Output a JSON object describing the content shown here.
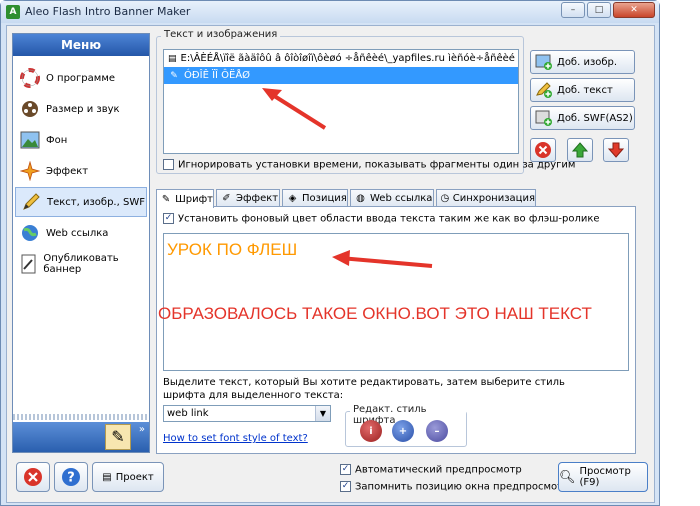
{
  "window": {
    "title": "Aleo Flash Intro Banner Maker"
  },
  "sidebar": {
    "header": "Меню",
    "items": [
      {
        "label": "О программе",
        "icon": "lifebuoy-icon"
      },
      {
        "label": "Размер и звук",
        "icon": "film-reel-icon"
      },
      {
        "label": "Фон",
        "icon": "picture-icon"
      },
      {
        "label": "Эффект",
        "icon": "sparkle-icon"
      },
      {
        "label": "Текст, изобр., SWF",
        "icon": "pencil-icon"
      },
      {
        "label": "Web ссылка",
        "icon": "globe-icon"
      },
      {
        "label": "Опубликовать баннер",
        "icon": "document-icon"
      }
    ]
  },
  "texts_images": {
    "group_title": "Текст и изображения",
    "rows": [
      {
        "text": "E:\\ÂÈÉÅ\\ïîë ãàäîôû â ôîòîøîï\\ôèøó ÷åñêèé\\_yapfiles.ru ìèñóè÷åñêèé ýôôåêò",
        "selected": false
      },
      {
        "text": "ÓÐÎÊ ÏÎ ÔËÅØ",
        "selected": true
      }
    ],
    "ignore_checkbox": "Игнорировать установки времени, показывать фрагменты один за другим"
  },
  "right_buttons": {
    "add_image": "Доб. изобр.",
    "add_text": "Доб. текст",
    "add_swf": "Доб. SWF(AS2)"
  },
  "tabs": [
    {
      "label": "Шрифт",
      "icon": "font-icon"
    },
    {
      "label": "Эффект",
      "icon": "brush-icon"
    },
    {
      "label": "Позиция",
      "icon": "tag-icon"
    },
    {
      "label": "Web ссылка",
      "icon": "globe-icon"
    },
    {
      "label": "Синхронизация",
      "icon": "clock-icon"
    }
  ],
  "font_panel": {
    "bg_checkbox": "Установить фоновый цвет области ввода текста таким же как во флэш-ролике",
    "editor_text": "УРОК ПО ФЛЕШ",
    "hint": "Выделите текст, который Вы хотите редактировать, затем выберите стиль шрифта для выделенного текста:",
    "combo_value": "web link",
    "style_group_title": "Редакт. стиль шрифта",
    "link": "How to set font style of text?"
  },
  "annotation": "ОБРАЗОВАЛОСЬ ТАКОЕ ОКНО.ВОТ ЭТО НАШ ТЕКСТ",
  "footer": {
    "project_button": "Проект",
    "auto_preview": "Автоматический предпросмотр",
    "remember_position": "Запомнить позицию окна предпросмотра",
    "preview_button": "Просмотр (F9)"
  },
  "colors": {
    "accent": "#3399ff",
    "editor_text": "#ff9900",
    "annotation": "#e4342a"
  }
}
